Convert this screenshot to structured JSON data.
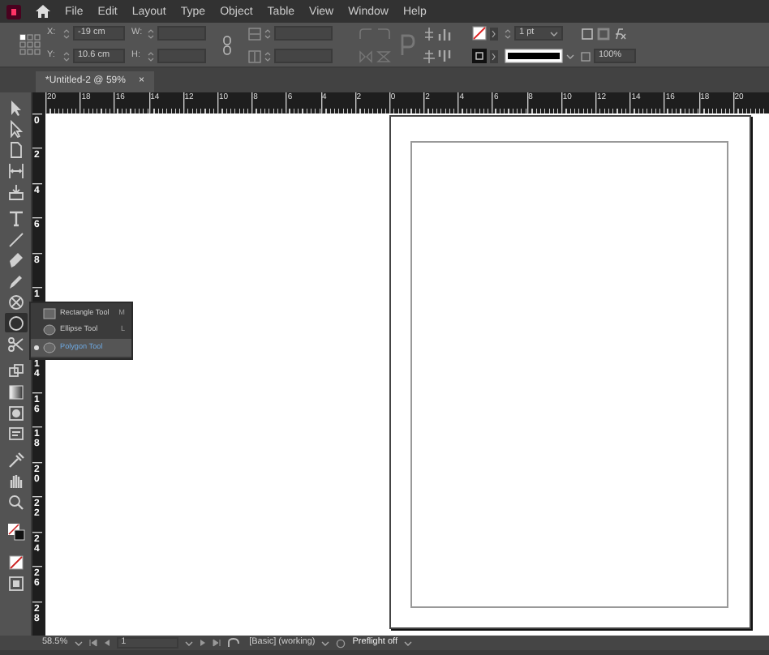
{
  "app": {
    "menus": [
      "File",
      "Edit",
      "Layout",
      "Type",
      "Object",
      "Table",
      "View",
      "Window",
      "Help"
    ]
  },
  "control_bar": {
    "x_label": "X:",
    "x": "-19 cm",
    "y_label": "Y:",
    "y": "10.6 cm",
    "w_label": "W:",
    "h_label": "H:",
    "stroke_weight": "1 pt",
    "opacity": "100%"
  },
  "document_tab": {
    "title": "*Untitled-2 @ 59%",
    "close": "×",
    "selected": true
  },
  "rulers": {
    "horizontal": [
      "20",
      "18",
      "16",
      "14",
      "12",
      "10",
      "8",
      "6",
      "4",
      "2",
      "0",
      "2",
      "4",
      "6",
      "8",
      "10",
      "12",
      "14",
      "16",
      "18",
      "20"
    ],
    "vertical_above_flyout": [
      "0",
      "2",
      "4",
      "6",
      "8",
      "1"
    ],
    "vertical_below_flyout": [
      "14",
      "16",
      "18",
      "20",
      "22",
      "24",
      "26",
      "28"
    ]
  },
  "tools": [
    {
      "selected": false
    },
    {
      "selected": false
    },
    {
      "selected": false
    },
    {
      "selected": false
    },
    {
      "selected": false
    },
    {
      "selected": false
    },
    {
      "selected": false
    },
    {
      "selected": false
    },
    {
      "selected": false
    },
    {
      "selected": false
    },
    {
      "selected": true
    },
    {
      "selected": false
    },
    {
      "selected": false
    },
    {
      "selected": false
    },
    {
      "selected": false
    },
    {
      "selected": false
    },
    {
      "selected": false
    },
    {
      "selected": false
    },
    {
      "selected": false
    },
    {
      "selected": false
    },
    {
      "selected": false
    },
    {
      "selected": false
    }
  ],
  "flyout": {
    "items": [
      {
        "label": "Rectangle Tool",
        "shortcut": "M",
        "selected": false
      },
      {
        "label": "Ellipse Tool",
        "shortcut": "L",
        "selected": false
      },
      {
        "label": "Polygon Tool",
        "selected": true
      }
    ]
  },
  "status_bar": {
    "zoom": "58.5%",
    "page": "1",
    "mode": "[Basic] (working)",
    "preflight": "Preflight off"
  }
}
